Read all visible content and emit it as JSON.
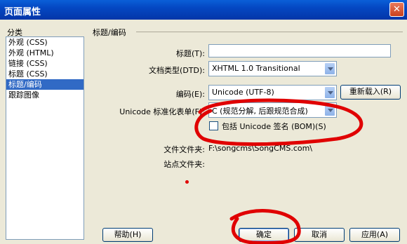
{
  "window": {
    "title": "页面属性",
    "close_glyph": "✕"
  },
  "sidebar": {
    "heading": "分类",
    "items": [
      {
        "label": "外观 (CSS)",
        "selected": false
      },
      {
        "label": "外观 (HTML)",
        "selected": false
      },
      {
        "label": "链接 (CSS)",
        "selected": false
      },
      {
        "label": "标题 (CSS)",
        "selected": false
      },
      {
        "label": "标题/编码",
        "selected": true
      },
      {
        "label": "跟踪图像",
        "selected": false
      }
    ]
  },
  "panel": {
    "section_title": "标题/编码",
    "title_label": "标题(T):",
    "title_value": "",
    "doctype_label": "文档类型(DTD):",
    "doctype_value": "XHTML 1.0 Transitional",
    "encoding_label": "编码(E):",
    "encoding_value": "Unicode (UTF-8)",
    "reload_button": "重新载入(R)",
    "normalization_label": "Unicode 标准化表单(F):",
    "normalization_value": "C (规范分解, 后跟规范合成)",
    "bom_label": "包括 Unicode 签名 (BOM)(S)",
    "bom_checked": false,
    "doc_folder_label": "文件文件夹:",
    "doc_folder_value": "F:\\songcms\\SongCMS.com\\",
    "site_folder_label": "站点文件夹:",
    "site_folder_value": ""
  },
  "footer": {
    "help_button": "帮助(H)",
    "ok_button": "确定",
    "cancel_button": "取消",
    "apply_button": "应用(A)"
  },
  "colors": {
    "title_bar": "#0447c2",
    "selection": "#316ac5",
    "annotation": "#e00000"
  }
}
